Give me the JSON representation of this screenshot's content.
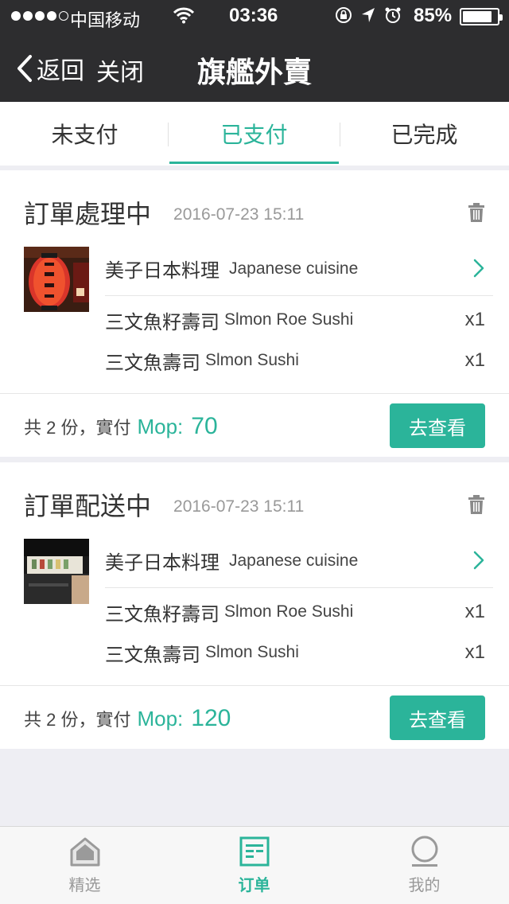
{
  "status_bar": {
    "carrier": "中国移动",
    "time": "03:36",
    "battery": "85%",
    "battery_level": 0.85
  },
  "nav": {
    "back_label": "返回",
    "close_label": "关闭",
    "title": "旗艦外賣"
  },
  "tabs": [
    {
      "label": "未支付",
      "active": false
    },
    {
      "label": "已支付",
      "active": true
    },
    {
      "label": "已完成",
      "active": false
    }
  ],
  "orders": [
    {
      "status": "訂單處理中",
      "date": "2016-07-23 15:11",
      "shop_name": "美子日本料理",
      "shop_en": "Japanese cuisine",
      "items": [
        {
          "name": "三文魚籽壽司",
          "en": "Slmon Roe Sushi",
          "qty": "x1"
        },
        {
          "name": "三文魚壽司",
          "en": "Slmon Sushi",
          "qty": "x1"
        }
      ],
      "total_text": "共 2 份，實付",
      "currency": "Mop:",
      "amount": "70",
      "button": "去查看"
    },
    {
      "status": "訂單配送中",
      "date": "2016-07-23 15:11",
      "shop_name": "美子日本料理",
      "shop_en": "Japanese cuisine",
      "items": [
        {
          "name": "三文魚籽壽司",
          "en": "Slmon Roe Sushi",
          "qty": "x1"
        },
        {
          "name": "三文魚壽司",
          "en": "Slmon Sushi",
          "qty": "x1"
        }
      ],
      "total_text": "共 2 份，實付",
      "currency": "Mop:",
      "amount": "120",
      "button": "去查看"
    }
  ],
  "tabbar": [
    {
      "label": "精选",
      "icon": "home-icon",
      "active": false
    },
    {
      "label": "订单",
      "icon": "order-list-icon",
      "active": true
    },
    {
      "label": "我的",
      "icon": "profile-icon",
      "active": false
    }
  ],
  "colors": {
    "accent": "#2bb49a",
    "header_bg": "#2d2d2f",
    "page_bg": "#eeeef3"
  }
}
